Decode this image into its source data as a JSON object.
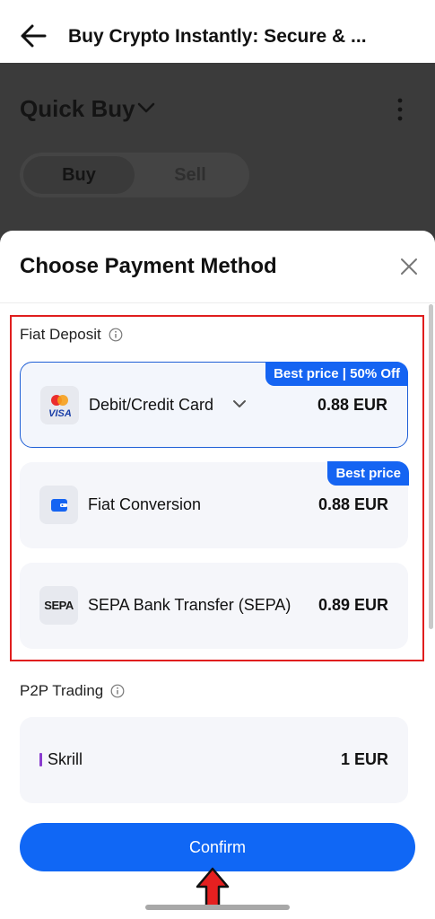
{
  "appbar": {
    "title": "Buy Crypto Instantly: Secure & ..."
  },
  "background_page": {
    "title": "Quick Buy",
    "tabs": [
      "Buy",
      "Sell"
    ]
  },
  "sheet": {
    "title": "Choose Payment Method",
    "fiat_section": {
      "label": "Fiat Deposit",
      "methods": [
        {
          "label": "Debit/Credit Card",
          "price": "0.88 EUR",
          "badge": "Best price | 50% Off",
          "selected": true
        },
        {
          "label": "Fiat Conversion",
          "price": "0.88 EUR",
          "badge": "Best price",
          "selected": false
        },
        {
          "label": "SEPA Bank Transfer (SEPA)",
          "price": "0.89 EUR",
          "icon_text": "SEPA",
          "selected": false
        }
      ]
    },
    "p2p_section": {
      "label": "P2P Trading",
      "methods": [
        {
          "label": "Skrill",
          "price": "1 EUR"
        }
      ]
    },
    "confirm_label": "Confirm"
  },
  "colors": {
    "accent": "#1067f5",
    "badge": "#1564f2",
    "highlight_box": "#e01e1e",
    "skrill": "#8a3ccf"
  },
  "icons": {
    "back": "back-arrow-icon",
    "dropdown": "chevron-down-icon",
    "more": "more-vertical-icon",
    "close": "close-icon",
    "info": "info-icon",
    "card": "mastercard-visa-icon",
    "conversion": "wallet-icon",
    "sepa": "sepa-logo-icon"
  }
}
